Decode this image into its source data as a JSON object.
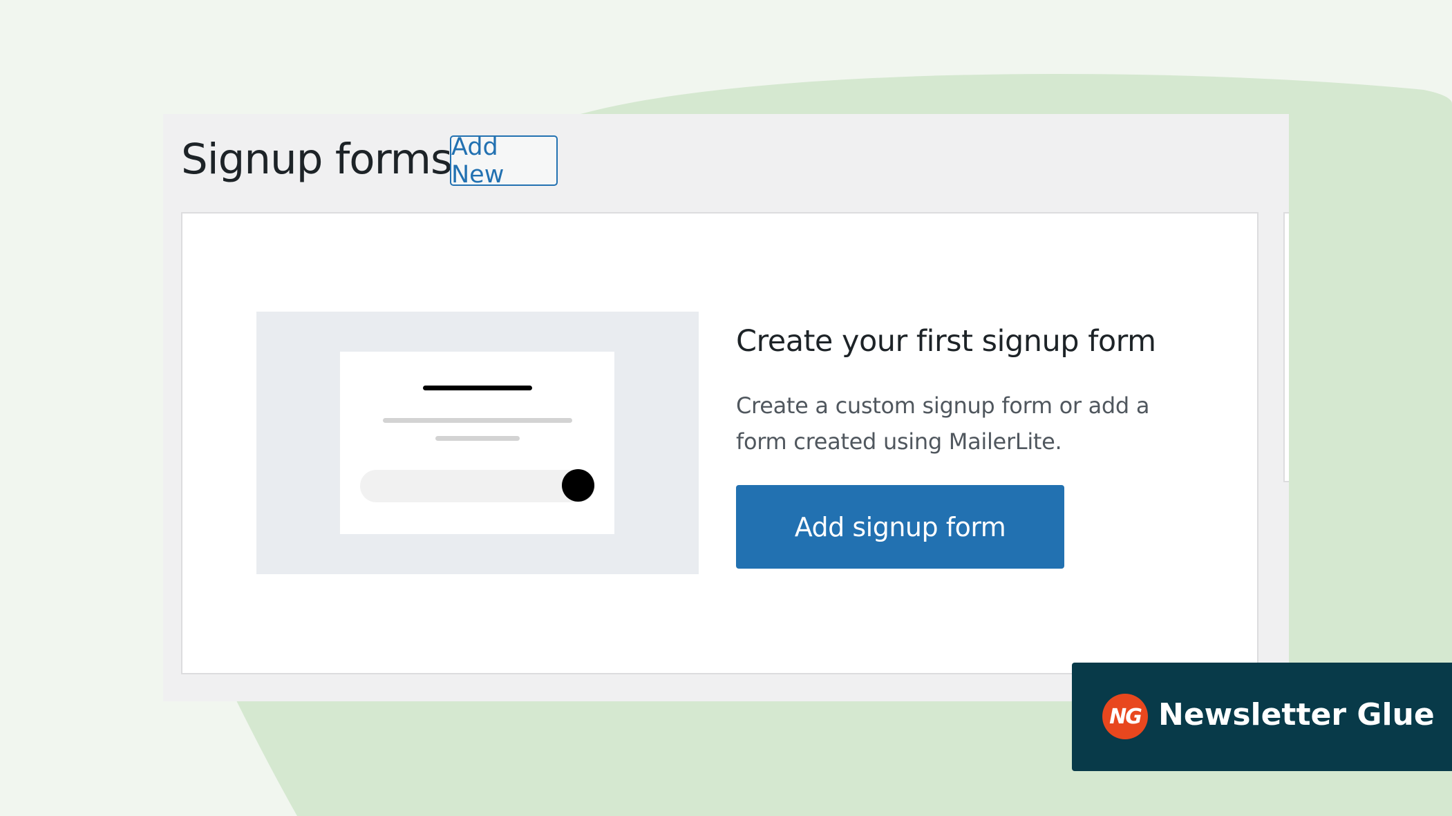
{
  "header": {
    "title": "Signup forms",
    "add_new_label": "Add New"
  },
  "empty_state": {
    "heading": "Create your first signup form",
    "description": "Create a custom signup form or add a form created using MailerLite.",
    "button_label": "Add signup form"
  },
  "brand": {
    "logo_text": "NG",
    "name": "Newsletter Glue"
  },
  "colors": {
    "accent": "#2271b1",
    "background": "#f1f6ef",
    "blob": "#d5e8d0",
    "brand_bar": "#083a49",
    "brand_logo": "#e8471e"
  },
  "icons": {
    "illustration": "signup-form-illustration"
  }
}
